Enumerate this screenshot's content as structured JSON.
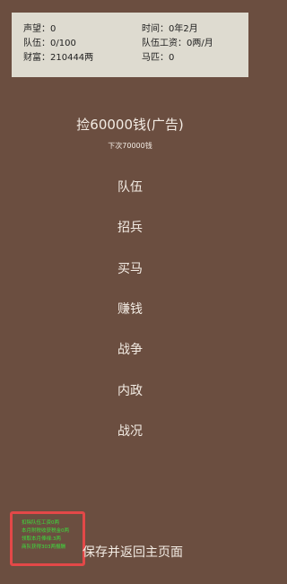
{
  "stats": {
    "reputation": "声望：0",
    "team": "队伍：0/100",
    "wealth": "财富：210444两",
    "time": "时间：0年2月",
    "salary": "队伍工资：0两/月",
    "horses": "马匹：0"
  },
  "ad_button": {
    "label": "捡60000钱(广告)",
    "next_hint": "下次70000钱"
  },
  "menu": {
    "items": [
      "队伍",
      "招兵",
      "买马",
      "赚钱",
      "战争",
      "内政",
      "战况"
    ]
  },
  "log": {
    "lines": [
      "扣除队伍工资0两",
      "本月附税收获税金0两",
      "领取本月俸禄:3两",
      "商队获得303两报酬"
    ],
    "border_color": "#e34848",
    "text_color": "#3ce03c"
  },
  "save_button": {
    "label": "保存并返回主页面"
  },
  "colors": {
    "background": "#6b4e40",
    "panel": "#dedbd0",
    "text": "#f3ece4"
  }
}
